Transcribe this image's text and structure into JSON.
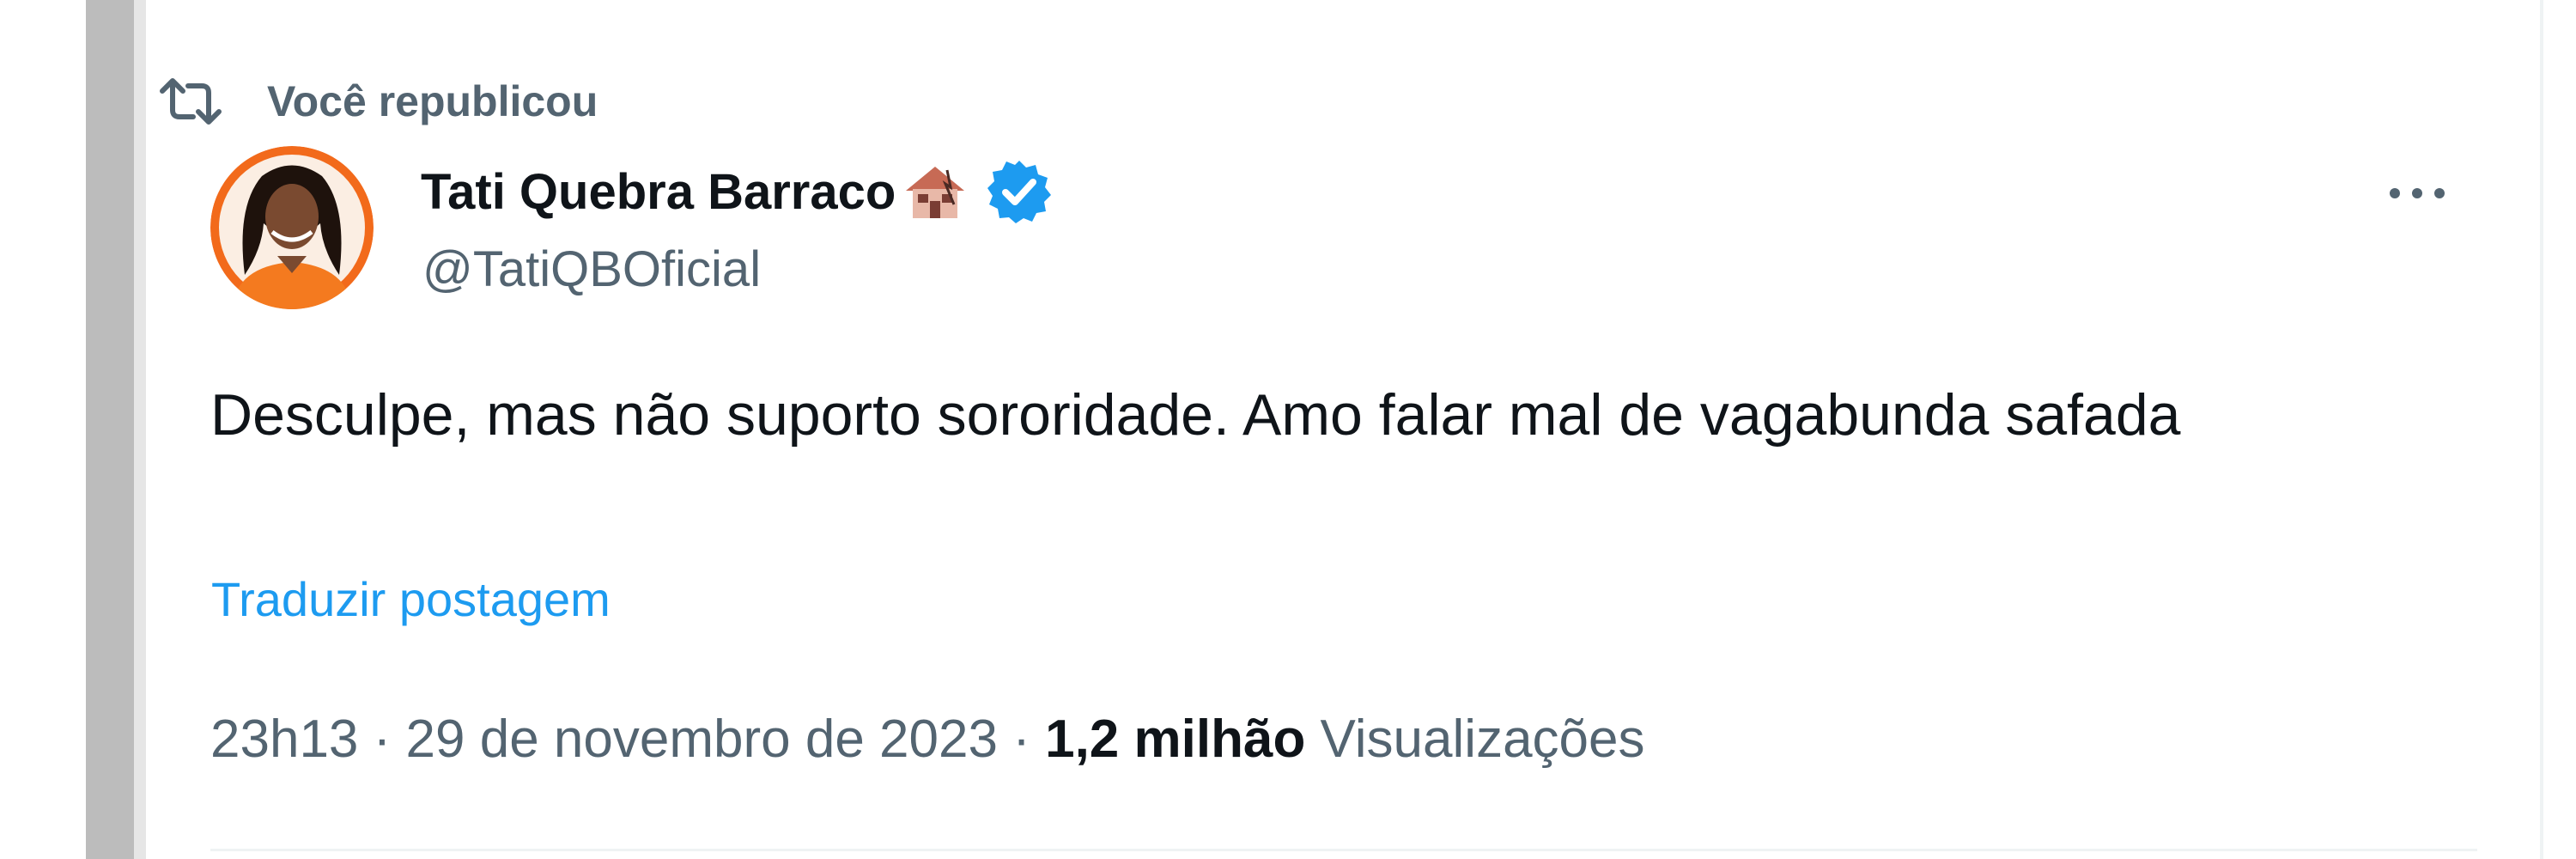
{
  "repost_header": {
    "icon": "repost-icon",
    "label": "Você republicou"
  },
  "author": {
    "display_name": "Tati Quebra Barraco",
    "name_emoji": "house-emoji",
    "verified_icon": "verified-badge-icon",
    "handle": "@TatiQBOficial"
  },
  "more_menu": {
    "icon": "more-dots-icon"
  },
  "tweet": {
    "text": "Desculpe, mas não suporto sororidade. Amo falar mal de vagabunda safada",
    "translate_label": "Traduzir postagem"
  },
  "meta": {
    "time": "23h13",
    "separator": "·",
    "date": "29 de novembro de 2023",
    "views_count": "1,2 milhão",
    "views_label": "Visualizações"
  },
  "colors": {
    "primary_text": "#0f1419",
    "secondary_text": "#536471",
    "link": "#1d9bf0",
    "verified": "#1d9bf0",
    "avatar_ring": "#f26a1b"
  }
}
